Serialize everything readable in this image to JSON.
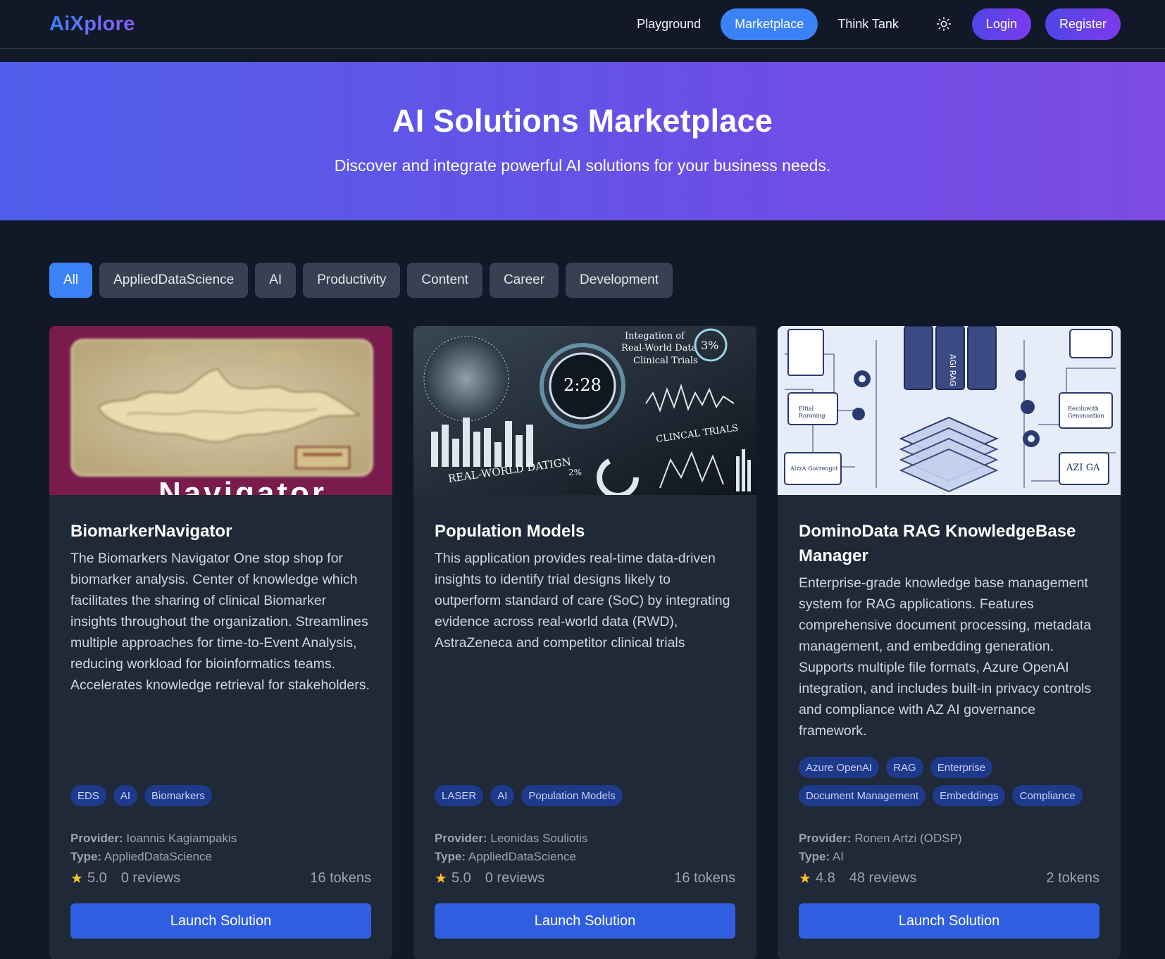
{
  "nav": {
    "logo": "AiXplore",
    "links": [
      "Playground",
      "Marketplace",
      "Think Tank"
    ],
    "active": "Marketplace",
    "theme_icon": "sun-icon",
    "login": "Login",
    "register": "Register"
  },
  "hero": {
    "title": "AI Solutions Marketplace",
    "subtitle": "Discover and integrate powerful AI solutions for your business needs."
  },
  "filters": [
    "All",
    "AppliedDataScience",
    "AI",
    "Productivity",
    "Content",
    "Career",
    "Development"
  ],
  "active_filter": "All",
  "cards": [
    {
      "title": "BiomarkerNavigator",
      "image_text": "Navigator",
      "description": "The Biomarkers Navigator One stop shop for biomarker analysis. Center of knowledge which facilitates the sharing of clinical Biomarker insights throughout the organization. Streamlines multiple approaches for time-to-Event Analysis, reducing workload for bioinformatics teams. Accelerates knowledge retrieval for stakeholders.",
      "tags": [
        "EDS",
        "AI",
        "Biomarkers"
      ],
      "provider_label": "Provider:",
      "provider": "Ioannis Kagiampakis",
      "type_label": "Type:",
      "type": "AppliedDataScience",
      "rating": "5.0",
      "reviews": "0 reviews",
      "tokens": "16 tokens",
      "button": "Launch Solution"
    },
    {
      "title": "Population Models",
      "image_text": "REAL-WORLD DATIGN",
      "image_text_2": "Integation of Real-World Data Clinical Trials",
      "image_clock": "2:28",
      "description": "This application provides real-time data-driven insights to identify trial designs likely to outperform standard of care (SoC) by integrating evidence across real-world data (RWD), AstraZeneca and competitor clinical trials",
      "tags": [
        "LASER",
        "AI",
        "Population Models"
      ],
      "provider_label": "Provider:",
      "provider": "Leonidas Souliotis",
      "type_label": "Type:",
      "type": "AppliedDataScience",
      "rating": "5.0",
      "reviews": "0 reviews",
      "tokens": "16 tokens",
      "button": "Launch Solution"
    },
    {
      "title": "DominoData RAG KnowledgeBase Manager",
      "image_text": "AGI RAG",
      "description": "Enterprise-grade knowledge base management system for RAG applications. Features comprehensive document processing, metadata management, and embedding generation. Supports multiple file formats, Azure OpenAI integration, and includes built-in privacy controls and compliance with AZ AI governance framework.",
      "tags": [
        "Azure OpenAI",
        "RAG",
        "Enterprise",
        "Document Management",
        "Embeddings",
        "Compliance"
      ],
      "provider_label": "Provider:",
      "provider": "Ronen Artzi (ODSP)",
      "type_label": "Type:",
      "type": "AI",
      "rating": "4.8",
      "reviews": "48 reviews",
      "tokens": "2 tokens",
      "button": "Launch Solution"
    }
  ],
  "colors": {
    "background": "#111827",
    "card": "#1f2937",
    "accent": "#3b82f6",
    "button": "#2f5fe0",
    "star": "#fbbf24"
  }
}
